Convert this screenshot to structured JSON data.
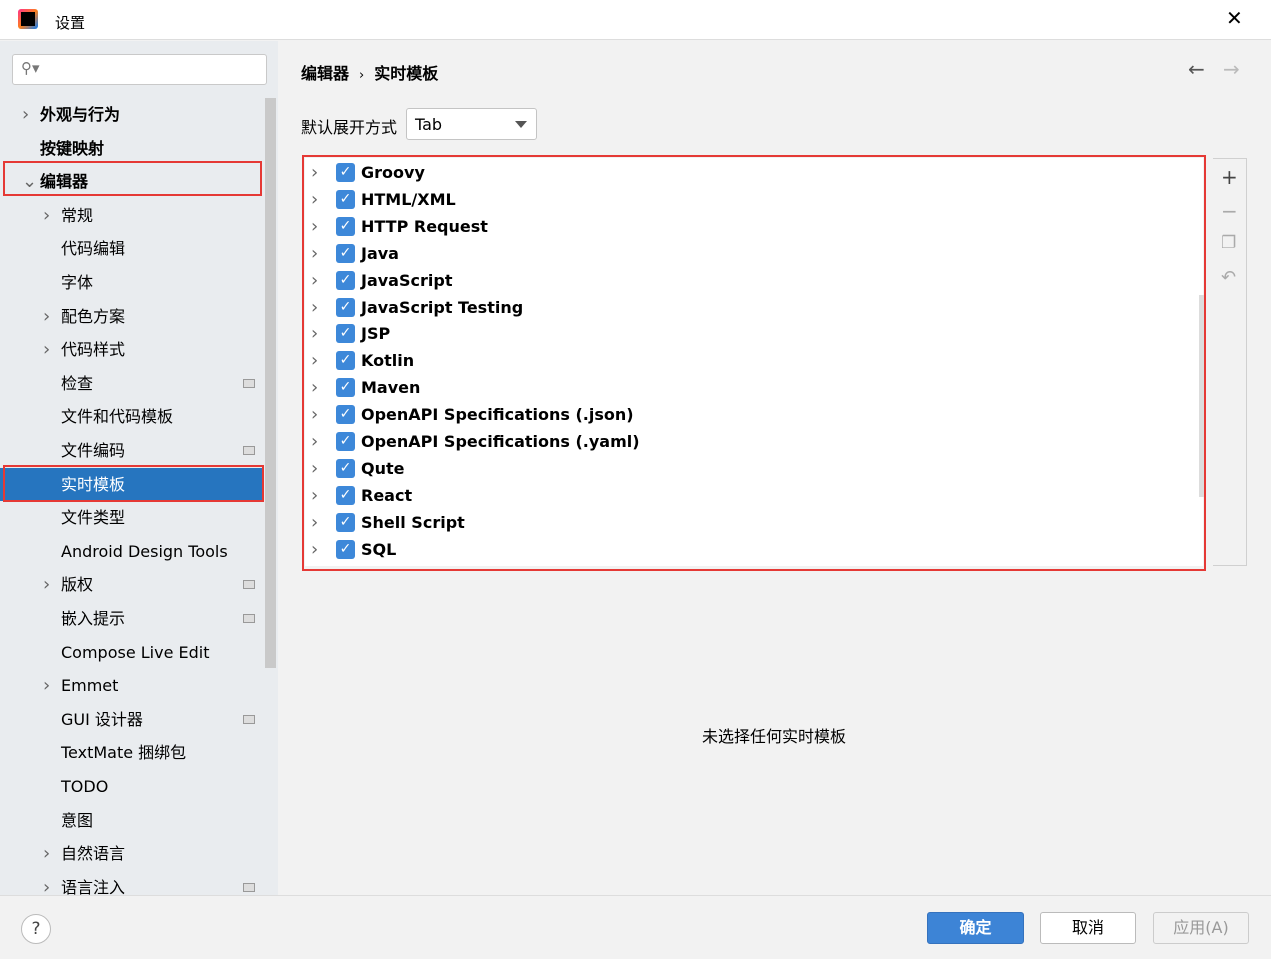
{
  "window": {
    "title": "设置",
    "close_icon": "close-icon"
  },
  "sidebar": {
    "search_placeholder": "",
    "items": [
      {
        "label": "外观与行为",
        "level": 0,
        "expand": "collapsed"
      },
      {
        "label": "按键映射",
        "level": 0
      },
      {
        "label": "编辑器",
        "level": 0,
        "expand": "expanded"
      },
      {
        "label": "常规",
        "level": 1,
        "expand": "collapsed"
      },
      {
        "label": "代码编辑",
        "level": 1
      },
      {
        "label": "字体",
        "level": 1
      },
      {
        "label": "配色方案",
        "level": 1,
        "expand": "collapsed"
      },
      {
        "label": "代码样式",
        "level": 1,
        "expand": "collapsed"
      },
      {
        "label": "检查",
        "level": 1,
        "project": true
      },
      {
        "label": "文件和代码模板",
        "level": 1
      },
      {
        "label": "文件编码",
        "level": 1,
        "project": true
      },
      {
        "label": "实时模板",
        "level": 1,
        "selected": true
      },
      {
        "label": "文件类型",
        "level": 1
      },
      {
        "label": "Android Design Tools",
        "level": 1
      },
      {
        "label": "版权",
        "level": 1,
        "expand": "collapsed",
        "project": true
      },
      {
        "label": "嵌入提示",
        "level": 1,
        "project": true
      },
      {
        "label": "Compose Live Edit",
        "level": 1
      },
      {
        "label": "Emmet",
        "level": 1,
        "expand": "collapsed"
      },
      {
        "label": "GUI 设计器",
        "level": 1,
        "project": true
      },
      {
        "label": "TextMate 捆绑包",
        "level": 1
      },
      {
        "label": "TODO",
        "level": 1
      },
      {
        "label": "意图",
        "level": 1
      },
      {
        "label": "自然语言",
        "level": 1,
        "expand": "collapsed"
      },
      {
        "label": "语言注入",
        "level": 1,
        "expand": "collapsed",
        "project": true
      }
    ]
  },
  "breadcrumb": [
    "编辑器",
    "实时模板"
  ],
  "expand_with": {
    "label": "默认展开方式",
    "value": "Tab"
  },
  "templates": [
    "Groovy",
    "HTML/XML",
    "HTTP Request",
    "Java",
    "JavaScript",
    "JavaScript Testing",
    "JSP",
    "Kotlin",
    "Maven",
    "OpenAPI Specifications (.json)",
    "OpenAPI Specifications (.yaml)",
    "Qute",
    "React",
    "Shell Script",
    "SQL"
  ],
  "empty_text": "未选择任何实时模板",
  "footer": {
    "help": "?",
    "ok": "确定",
    "cancel": "取消",
    "apply": "应用(A)"
  },
  "colors": {
    "accent": "#2675bf",
    "highlight": "#e53935"
  }
}
